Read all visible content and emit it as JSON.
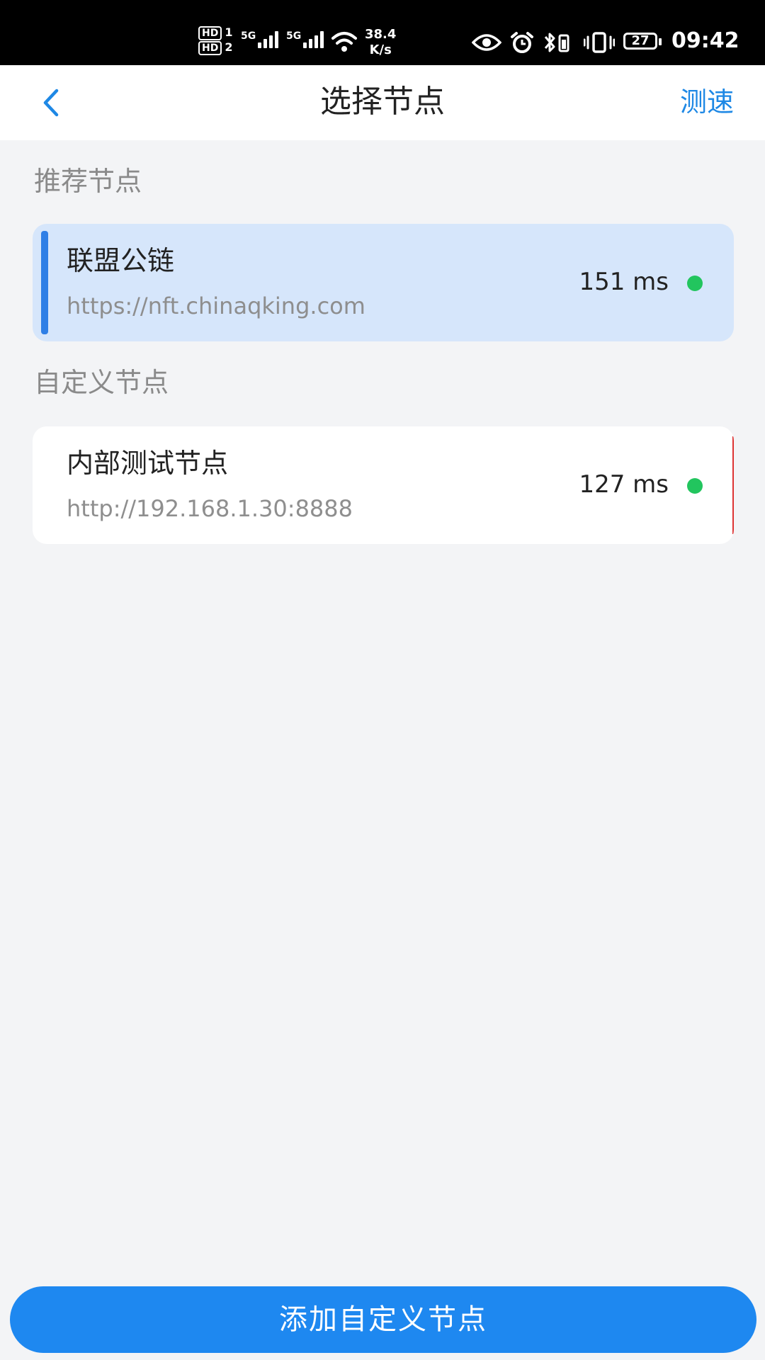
{
  "status_bar": {
    "hd1": "HD",
    "hd1_sub": "1",
    "hd2": "HD",
    "hd2_sub": "2",
    "net1": "5G",
    "net2": "5G",
    "speed_value": "38.4",
    "speed_unit": "K/s",
    "battery": "27",
    "time": "09:42"
  },
  "header": {
    "title": "选择节点",
    "action_label": "测速"
  },
  "recommended": {
    "section_title": "推荐节点",
    "nodes": [
      {
        "name": "联盟公链",
        "url": "https://nft.chinaqking.com",
        "latency": "151 ms"
      }
    ]
  },
  "custom": {
    "section_title": "自定义节点",
    "nodes": [
      {
        "name": "内部测试节点",
        "url": "http://192.168.1.30:8888",
        "latency": "127 ms"
      }
    ]
  },
  "footer": {
    "add_button_label": "添加自定义节点"
  },
  "colors": {
    "accent": "#1e88e5",
    "selected_bg": "#d6e6fb",
    "status_ok": "#22c55e"
  }
}
